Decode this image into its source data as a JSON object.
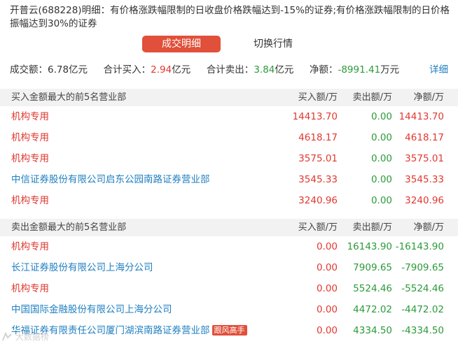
{
  "description": "开普云(688228)明细：有价格涨跌幅限制的日收盘价格跌幅达到-15%的证券;有价格涨跌幅限制的日价格振幅达到30%的证券",
  "tabs": {
    "active": "成交明细",
    "inactive": "切换行情"
  },
  "summary": {
    "turnover_label": "成交额：",
    "turnover_value": "6.78亿元",
    "buy_label": "合计买入：",
    "buy_value": "2.94",
    "buy_unit": "亿元",
    "sell_label": "合计卖出：",
    "sell_value": "3.84",
    "sell_unit": "亿元",
    "net_label": "净额：",
    "net_value": "-8991.41",
    "net_unit": "万元",
    "detail_link": "详细"
  },
  "colors": {
    "accent": "#e0503a",
    "red": "#e0382f",
    "green": "#2b9a3a",
    "blue": "#1f7fc0"
  },
  "buy_section": {
    "title": "买入金额最大的前5名营业部",
    "columns": [
      "买入额/万",
      "卖出额/万",
      "净额/万"
    ],
    "rows": [
      {
        "name": "机构专用",
        "name_color": "red",
        "buy": "14413.70",
        "sell": "0.00",
        "net": "14413.70"
      },
      {
        "name": "机构专用",
        "name_color": "red",
        "buy": "4618.17",
        "sell": "0.00",
        "net": "4618.17"
      },
      {
        "name": "机构专用",
        "name_color": "red",
        "buy": "3575.01",
        "sell": "0.00",
        "net": "3575.01"
      },
      {
        "name": "中信证券股份有限公司启东公园南路证券营业部",
        "name_color": "blue",
        "buy": "3545.33",
        "sell": "0.00",
        "net": "3545.33"
      },
      {
        "name": "机构专用",
        "name_color": "red",
        "buy": "3240.96",
        "sell": "0.00",
        "net": "3240.96"
      }
    ]
  },
  "sell_section": {
    "title": "卖出金额最大的前5名营业部",
    "columns": [
      "买入额/万",
      "卖出额/万",
      "净额/万"
    ],
    "rows": [
      {
        "name": "机构专用",
        "name_color": "red",
        "buy": "0.00",
        "sell": "16143.90",
        "net": "-16143.90"
      },
      {
        "name": "长江证券股份有限公司上海分公司",
        "name_color": "blue",
        "buy": "0.00",
        "sell": "7909.65",
        "net": "-7909.65"
      },
      {
        "name": "机构专用",
        "name_color": "red",
        "buy": "0.00",
        "sell": "5524.46",
        "net": "-5524.46"
      },
      {
        "name": "中国国际金融股份有限公司上海分公司",
        "name_color": "blue",
        "buy": "0.00",
        "sell": "4472.02",
        "net": "-4472.02"
      },
      {
        "name": "华福证券有限责任公司厦门湖滨南路证券营业部",
        "name_color": "blue",
        "badge": "跟风高手",
        "buy": "0.00",
        "sell": "4334.50",
        "net": "-4334.50"
      }
    ]
  },
  "watermark": {
    "icon": "logo-icon",
    "text": "大数据榜"
  }
}
